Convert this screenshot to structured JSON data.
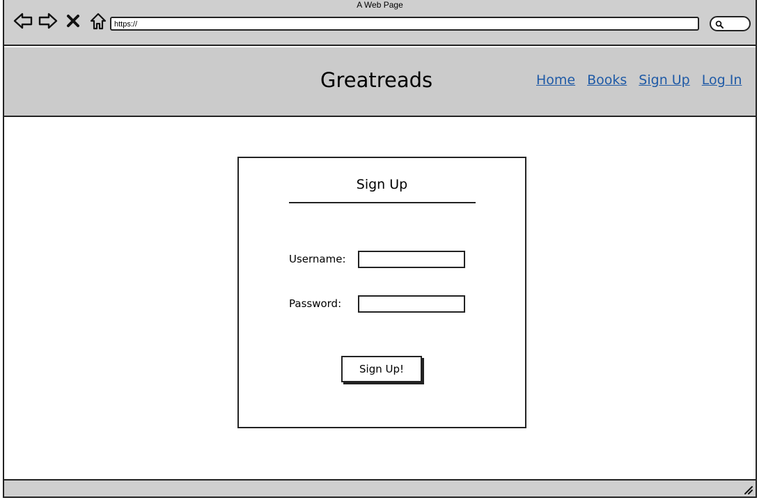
{
  "browser": {
    "window_title": "A Web Page",
    "address": "https://",
    "icons": [
      "back-arrow-icon",
      "forward-arrow-icon",
      "close-icon",
      "home-icon",
      "search-icon"
    ]
  },
  "header": {
    "site_title": "Greatreads",
    "nav": [
      "Home",
      "Books",
      "Sign Up",
      "Log In"
    ],
    "link_color": "#1f5aa6"
  },
  "signup": {
    "title": "Sign Up",
    "username_label": "Username:",
    "username_value": "",
    "password_label": "Password:",
    "password_value": "",
    "submit_label": "Sign Up!"
  }
}
